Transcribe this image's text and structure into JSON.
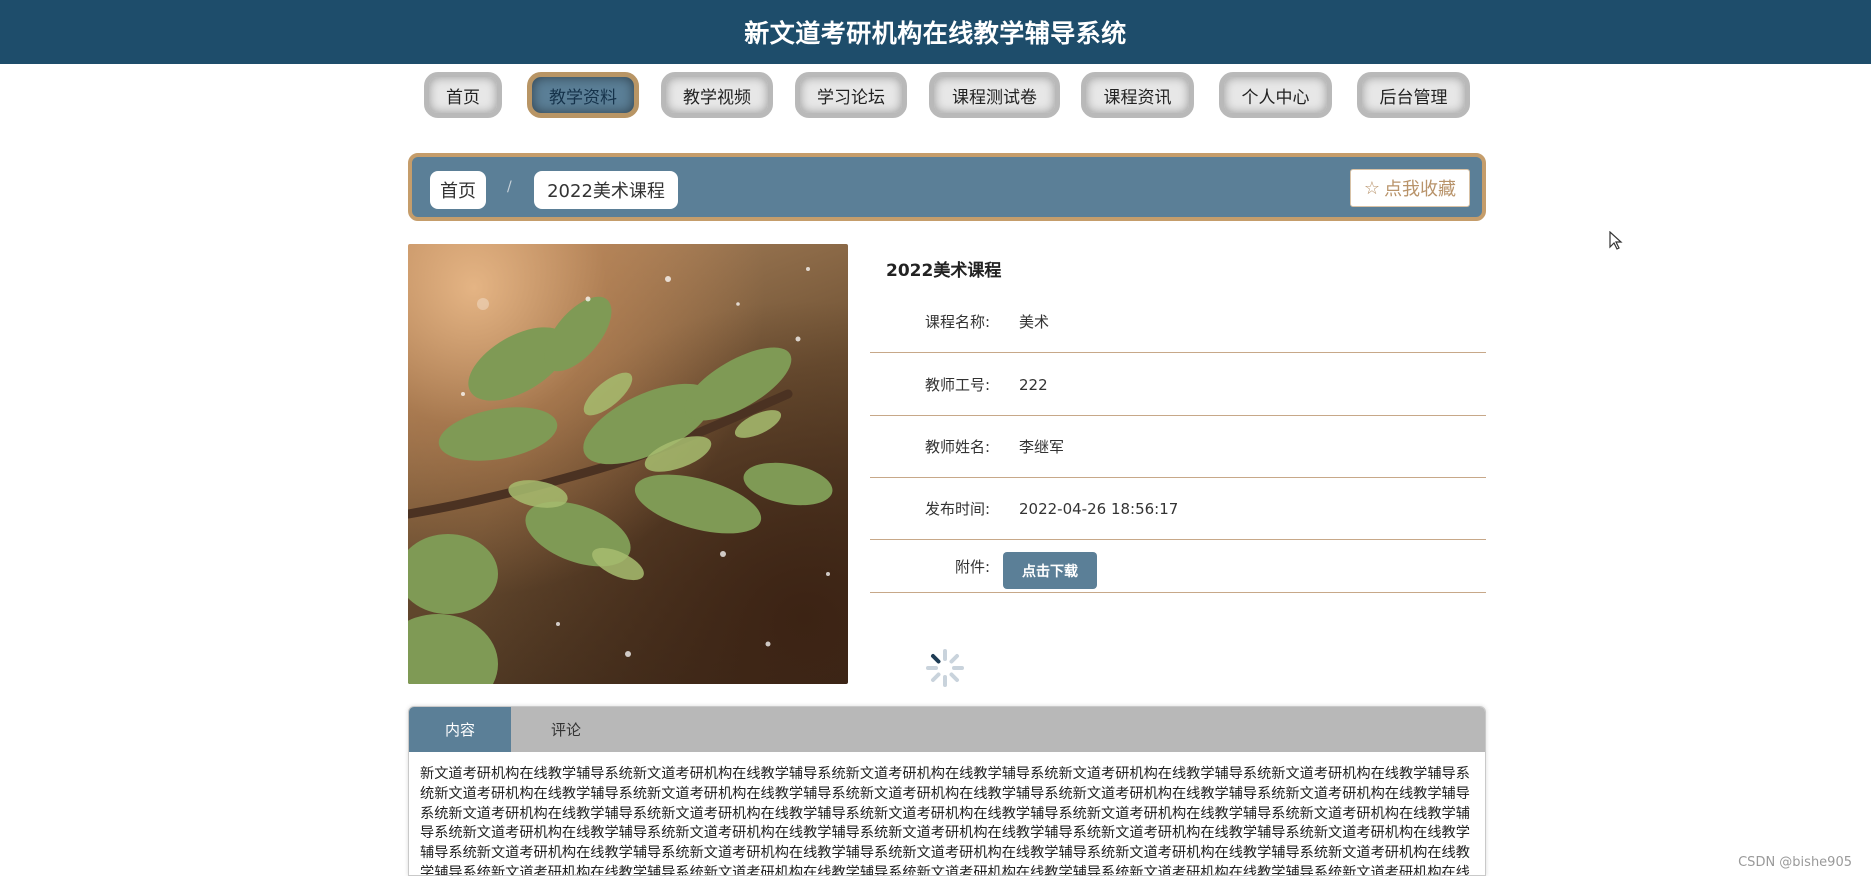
{
  "header": {
    "title": "新文道考研机构在线教学辅导系统"
  },
  "nav": {
    "items": [
      {
        "label": "首页",
        "active": false
      },
      {
        "label": "教学资料",
        "active": true
      },
      {
        "label": "教学视频",
        "active": false
      },
      {
        "label": "学习论坛",
        "active": false
      },
      {
        "label": "课程测试卷",
        "active": false
      },
      {
        "label": "课程资讯",
        "active": false
      },
      {
        "label": "个人中心",
        "active": false
      },
      {
        "label": "后台管理",
        "active": false
      }
    ]
  },
  "breadcrumb": {
    "home": "首页",
    "separator": "/",
    "current": "2022美术课程"
  },
  "favorite": {
    "label": "点我收藏",
    "icon": "star-outline-icon"
  },
  "detail": {
    "title": "2022美术课程",
    "rows": [
      {
        "label": "课程名称:",
        "value": "美术"
      },
      {
        "label": "教师工号:",
        "value": "222"
      },
      {
        "label": "教师姓名:",
        "value": "李继军"
      },
      {
        "label": "发布时间:",
        "value": "2022-04-26 18:56:17"
      }
    ],
    "attachment": {
      "label": "附件:",
      "button": "点击下载"
    }
  },
  "tabs": [
    {
      "label": "内容",
      "active": true
    },
    {
      "label": "评论",
      "active": false
    }
  ],
  "content": {
    "text": "新文道考研机构在线教学辅导系统新文道考研机构在线教学辅导系统新文道考研机构在线教学辅导系统新文道考研机构在线教学辅导系统新文道考研机构在线教学辅导系统新文道考研机构在线教学辅导系统新文道考研机构在线教学辅导系统新文道考研机构在线教学辅导系统新文道考研机构在线教学辅导系统新文道考研机构在线教学辅导系统新文道考研机构在线教学辅导系统新文道考研机构在线教学辅导系统新文道考研机构在线教学辅导系统新文道考研机构在线教学辅导系统新文道考研机构在线教学辅导系统新文道考研机构在线教学辅导系统新文道考研机构在线教学辅导系统新文道考研机构在线教学辅导系统新文道考研机构在线教学辅导系统新文道考研机构在线教学辅导系统新文道考研机构在线教学辅导系统新文道考研机构在线教学辅导系统新文道考研机构在线教学辅导系统新文道考研机构在线教学辅导系统新文道考研机构在线教学辅导系统新文道考研机构在线教学辅导系统新文道考研机构在线教学辅导系统新文道考研机构在线教学辅导系统新文道考研机构在线教学辅导系统新文道考研机构在线教学辅导系统新文道考研机构在线教学辅导系统新文道考研机构在线教学辅导系统新文道"
  },
  "watermark": "CSDN @bishe905",
  "colors": {
    "header": "#1e4d6b",
    "accent": "#5b7f97",
    "border_gold": "#c59d6b"
  }
}
